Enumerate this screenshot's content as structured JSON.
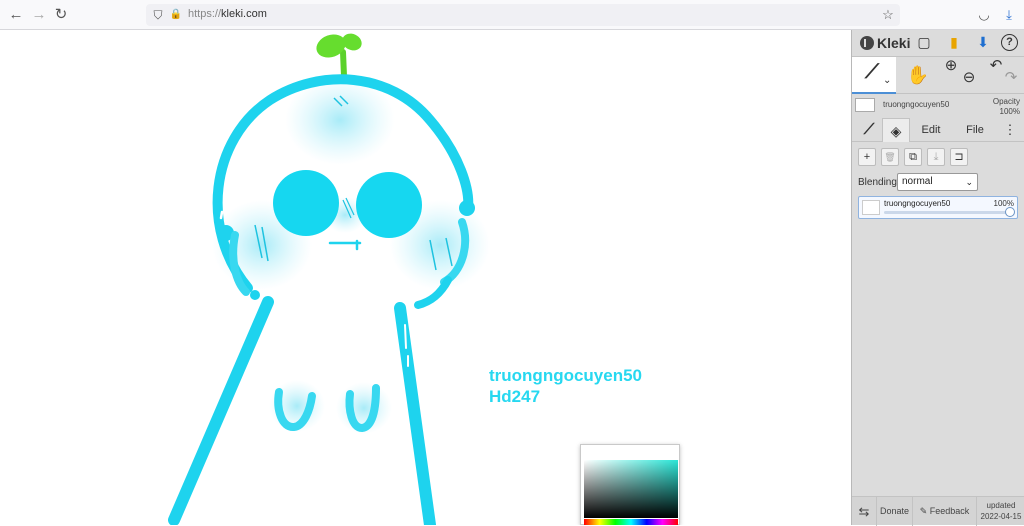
{
  "browser": {
    "url_scheme": "https://",
    "url_host": "kleki.com",
    "back_icon": "←",
    "forward_icon": "→",
    "reload_icon": "↻",
    "shield_icon": "⛉",
    "lock_icon": "🔒",
    "star_icon": "☆",
    "pocket_icon": "◡",
    "downloads_icon": "⤓",
    "menu_icon": "≡"
  },
  "canvas": {
    "signature_line1": "truongngocuyen50",
    "signature_line2": "Hd247",
    "accent_color": "#27d8f0"
  },
  "panel": {
    "app_name": "Kleki",
    "new_icon": "▢",
    "save_icon": "▮",
    "download_icon": "⬇",
    "help_icon": "?",
    "brush_icon": "⟋",
    "brush_caret": "⌄",
    "hand_icon": "✋",
    "zoom_in_icon": "⊕",
    "zoom_out_icon": "⊖",
    "undo_icon": "↶",
    "redo_icon": "↷",
    "layer_name": "truongngocuyen50",
    "opacity_label": "Opacity",
    "opacity_value": "100%",
    "tab_brush_icon": "⟋",
    "tab_layers_icon": "◈",
    "tab_edit": "Edit",
    "tab_file": "File",
    "more_icon": "⋮",
    "layer_actions": {
      "add": "+",
      "delete": "🗑",
      "duplicate": "⧉",
      "merge": "⤓",
      "more": "⊐"
    },
    "blending_label": "Blending",
    "blending_value": "normal",
    "blending_caret": "⌄",
    "layer_item_name": "truongngocuyen50",
    "layer_item_opacity": "100%",
    "bottom": {
      "swap_icon": "⇆",
      "donate": "Donate",
      "feedback": "Feedback",
      "feedback_icon": "✎",
      "updated_label": "updated",
      "updated_date": "2022-04-15"
    }
  }
}
